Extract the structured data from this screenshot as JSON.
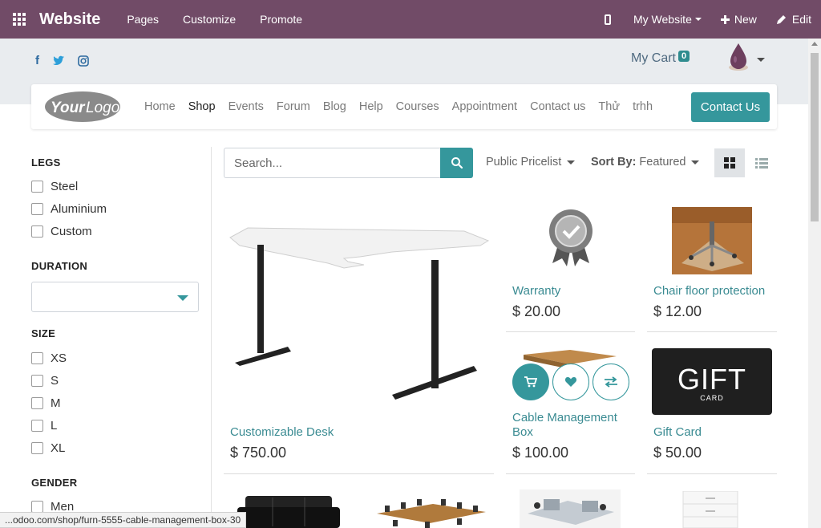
{
  "topbar": {
    "brand": "Website",
    "menu": [
      "Pages",
      "Customize",
      "Promote"
    ],
    "website_selector": "My Website",
    "new_label": "New",
    "edit_label": "Edit"
  },
  "header": {
    "social": [
      "f",
      "twitter",
      "instagram"
    ],
    "cart_label": "My Cart",
    "cart_count": "0"
  },
  "navbar": {
    "logo_text": "YourLogo",
    "links": [
      "Home",
      "Shop",
      "Events",
      "Forum",
      "Blog",
      "Help",
      "Courses",
      "Appointment",
      "Contact us",
      "Thử",
      "trhh"
    ],
    "active": "Shop",
    "contact_button": "Contact Us"
  },
  "filters": {
    "legs": {
      "title": "LEGS",
      "options": [
        "Steel",
        "Aluminium",
        "Custom"
      ]
    },
    "duration": {
      "title": "DURATION",
      "selected": ""
    },
    "size": {
      "title": "SIZE",
      "options": [
        "XS",
        "S",
        "M",
        "L",
        "XL"
      ]
    },
    "gender": {
      "title": "GENDER",
      "options": [
        "Men"
      ]
    }
  },
  "toolbar": {
    "search_placeholder": "Search...",
    "pricelist": "Public Pricelist",
    "sort_label": "Sort By:",
    "sort_value": "Featured"
  },
  "products": [
    {
      "name": "Customizable Desk",
      "price": "$ 750.00"
    },
    {
      "name": "Warranty",
      "price": "$ 20.00"
    },
    {
      "name": "Chair floor protection",
      "price": "$ 12.00"
    },
    {
      "name": "Cable Management Box",
      "price": "$ 100.00"
    },
    {
      "name": "Gift Card",
      "price": "$ 50.00"
    }
  ],
  "gift_card_art": {
    "line1": "GIFT",
    "line2": "CARD"
  },
  "statusbar": {
    "url": "...odoo.com/shop/furn-5555-cable-management-box-30"
  },
  "colors": {
    "brand": "#714B67",
    "accent": "#35979c",
    "link": "#3a8b92"
  }
}
